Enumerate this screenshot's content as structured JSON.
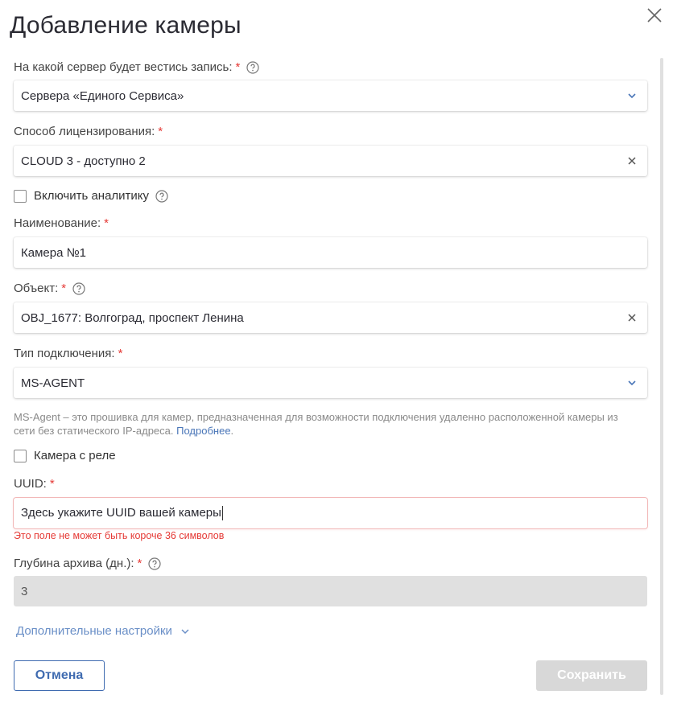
{
  "dialog": {
    "title": "Добавление камеры",
    "close_icon": "close-icon"
  },
  "server": {
    "label": "На какой сервер будет вестись запись:",
    "required_mark": "*",
    "value": "Сервера «Единого Сервиса»"
  },
  "licensing": {
    "label": "Способ лицензирования:",
    "required_mark": "*",
    "value": "CLOUD 3 - доступно 2"
  },
  "analytics": {
    "label": "Включить аналитику",
    "checked": false
  },
  "name": {
    "label": "Наименование:",
    "required_mark": "*",
    "value": "Камера №1"
  },
  "object": {
    "label": "Объект:",
    "required_mark": "*",
    "value": "OBJ_1677: Волгоград, проспект Ленина"
  },
  "connection": {
    "label": "Тип подключения:",
    "required_mark": "*",
    "value": "MS-AGENT",
    "hint": "MS-Agent – это прошивка для камер, предназначенная для возможности подключения удаленно расположенной камеры из сети без статического IP-адреса.",
    "hint_link": "Подробнее",
    "hint_end": "."
  },
  "relay": {
    "label": "Камера с реле",
    "checked": false
  },
  "uuid": {
    "label": "UUID:",
    "required_mark": "*",
    "value": "Здесь укажите UUID вашей камеры",
    "error": "Это поле не может быть короче 36 символов"
  },
  "archive": {
    "label": "Глубина архива (дн.):",
    "required_mark": "*",
    "value": "3"
  },
  "advanced": {
    "label": "Дополнительные настройки"
  },
  "buttons": {
    "cancel": "Отмена",
    "save": "Сохранить"
  },
  "colors": {
    "required": "#e53935",
    "link": "#4a76b8",
    "primary": "#3f6bb0",
    "disabled_button": "#d8d8d8"
  }
}
